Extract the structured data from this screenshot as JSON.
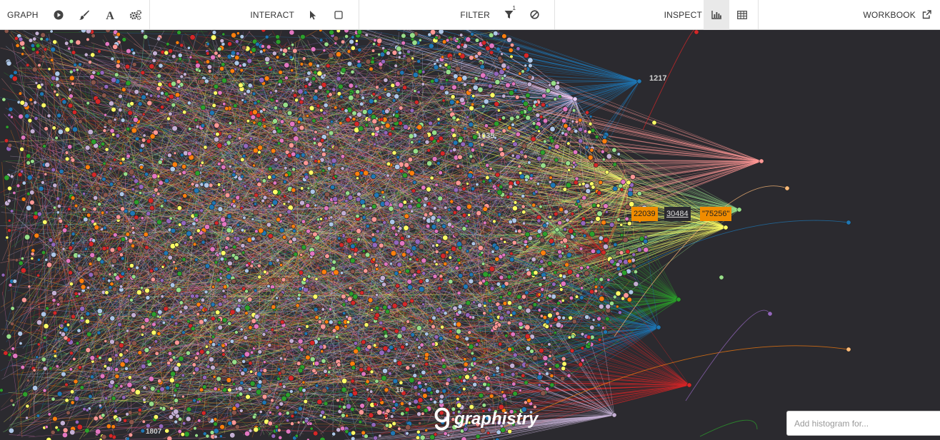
{
  "toolbar": {
    "graph_label": "GRAPH",
    "interact_label": "INTERACT",
    "filter_label": "FILTER",
    "filter_count": "1",
    "inspect_label": "INSPECT",
    "workbook_label": "WORKBOOK",
    "icons": {
      "play": "play-icon",
      "brush": "brush-icon",
      "text": "text-icon",
      "settings": "gears-icon",
      "pointer": "pointer-icon",
      "select": "box-select-icon",
      "filter": "filter-icon",
      "exclude": "exclude-icon",
      "histogram": "histogram-icon",
      "table": "table-icon",
      "external": "external-link-icon"
    }
  },
  "canvas": {
    "background": "#2b2a2f",
    "node_labels": [
      "1217",
      "1035",
      "16",
      "1807"
    ],
    "selection_labels": [
      "22039",
      "30484",
      "\"75256\""
    ],
    "palette": [
      "#1f77b4",
      "#ff7f0e",
      "#2ca02c",
      "#d62728",
      "#9467bd",
      "#8c564b",
      "#e377c2",
      "#ffff66",
      "#98df8a",
      "#aec7e8",
      "#ff9896",
      "#c5b0d5"
    ]
  },
  "logo": {
    "text": "graphistry"
  },
  "histogram": {
    "placeholder": "Add histogram for..."
  }
}
